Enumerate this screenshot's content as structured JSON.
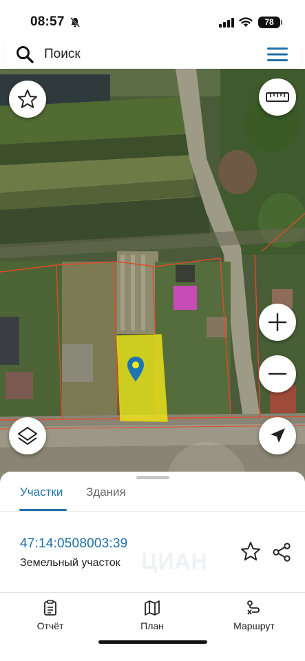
{
  "status_bar": {
    "time": "08:57",
    "battery": "78"
  },
  "search": {
    "placeholder": "Поиск"
  },
  "map": {
    "controls": [
      "favorite",
      "ruler",
      "zoom-in",
      "zoom-out",
      "layers",
      "locate"
    ],
    "colors": {
      "parcel_fill": "#f2ec1a",
      "parcel_border": "#e24a2c",
      "pin": "#1d74b5",
      "building_roof": "#c64bb6"
    }
  },
  "sheet": {
    "tabs": [
      {
        "label": "Участки",
        "active": true
      },
      {
        "label": "Здания",
        "active": false
      }
    ],
    "parcel": {
      "cadastral_number": "47:14:0508003:39",
      "type": "Земельный участок",
      "watermark": "ЦИАН"
    },
    "nav": [
      {
        "label": "Отчёт",
        "icon": "report-icon"
      },
      {
        "label": "План",
        "icon": "map-plan-icon"
      },
      {
        "label": "Маршрут",
        "icon": "route-icon"
      }
    ]
  },
  "accent_color": "#1d6fa8"
}
